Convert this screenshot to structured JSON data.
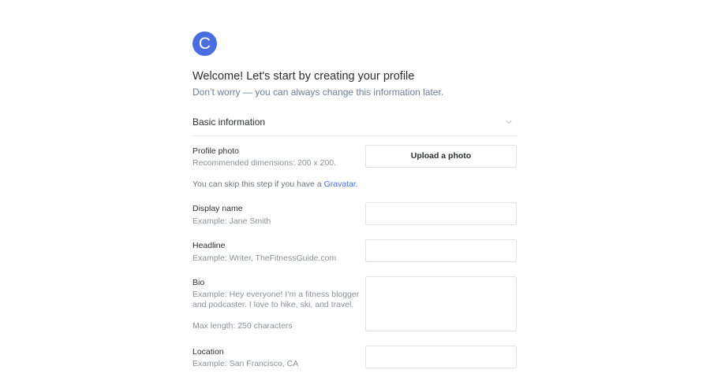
{
  "logo": {
    "letter": "C"
  },
  "header": {
    "title": "Welcome! Let's start by creating your profile",
    "subtitle": "Don’t worry — you can always change this information later."
  },
  "section": {
    "title": "Basic information",
    "icon": "chevron-down-icon"
  },
  "profile_photo": {
    "label": "Profile photo",
    "help": "Recommended dimensions: 200 x 200.",
    "skip_prefix": "You can skip this step if you have a ",
    "skip_link": "Gravatar",
    "skip_suffix": ".",
    "button_label": "Upload a photo"
  },
  "display_name": {
    "label": "Display name",
    "help": "Example: Jane Smith",
    "value": ""
  },
  "headline": {
    "label": "Headline",
    "help": "Example: Writer, TheFitnessGuide.com",
    "value": ""
  },
  "bio": {
    "label": "Bio",
    "help": "Example: Hey everyone! I’m a fitness blogger and podcaster. I love to hike, ski, and travel.",
    "max_length": "Max length: 250 characters",
    "value": ""
  },
  "location": {
    "label": "Location",
    "help": "Example: San Francisco, CA",
    "value": ""
  },
  "colors": {
    "accent": "#4a6ee0",
    "help_text": "#8a8f98",
    "subtitle": "#6b7e99"
  }
}
